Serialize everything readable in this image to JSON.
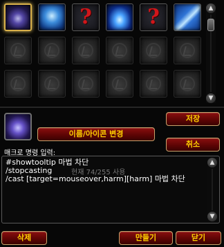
{
  "macro_icons": [
    {
      "icon": "void-orb-icon",
      "selected": true
    },
    {
      "icon": "frost-orb-icon",
      "selected": false
    },
    {
      "icon": "question-mark-icon",
      "selected": false,
      "text": "?"
    },
    {
      "icon": "blue-flame-icon",
      "selected": false
    },
    {
      "icon": "question-mark-icon",
      "selected": false,
      "text": "?"
    },
    {
      "icon": "frost-claw-icon",
      "selected": false
    }
  ],
  "selected_macro": {
    "icon": "void-orb-icon"
  },
  "buttons": {
    "change_name_icon": "이름/아이콘 변경",
    "save": "저장",
    "cancel": "취소",
    "delete": "삭제",
    "create": "만들기",
    "close": "닫기"
  },
  "editor": {
    "label": "매크로 명령 입력:",
    "lines": [
      "#showtooltip 마법 차단",
      "/stopcasting",
      "/cast [target=mouseover,harm][harm] 마법 차단"
    ],
    "char_count": "현재 74/255 사용"
  },
  "colors": {
    "button_bg": "#6a0808",
    "button_text": "#ffd100",
    "question_mark": "#d1161a",
    "selected_border": "#d9b04a"
  }
}
